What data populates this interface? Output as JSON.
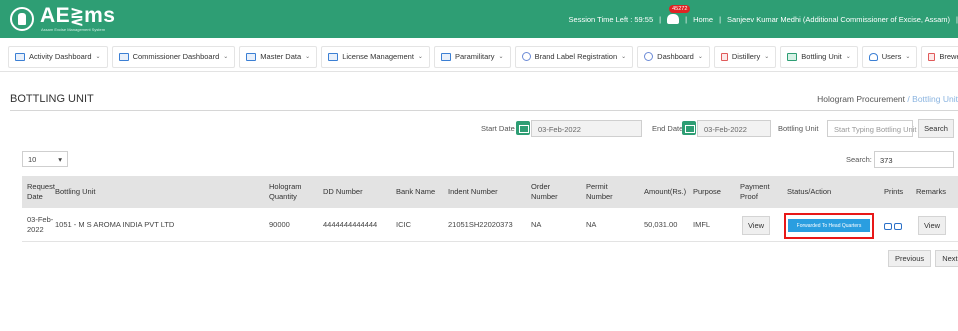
{
  "header": {
    "logo": "AE",
    "logo_tail": "ms",
    "logo_sub": "Assam Excise Management System",
    "session_label": "Session Time Left : 59:55",
    "notification_count": "45272",
    "home": "Home",
    "user": "Sanjeev Kumar Medhi (Additional Commissioner of Excise, Assam)",
    "divider": "|"
  },
  "nav": {
    "items": [
      {
        "label": "Activity Dashboard",
        "icon": "dashboard-icon"
      },
      {
        "label": "Commissioner Dashboard",
        "icon": "dashboard-icon"
      },
      {
        "label": "Master Data",
        "icon": "table-icon"
      },
      {
        "label": "License Management",
        "icon": "license-icon"
      },
      {
        "label": "Paramilitary",
        "icon": "table-icon"
      },
      {
        "label": "Brand Label Registration",
        "icon": "circle-icon"
      },
      {
        "label": "Dashboard",
        "icon": "clock-icon"
      },
      {
        "label": "Distillery",
        "icon": "flask-icon"
      },
      {
        "label": "Bottling Unit",
        "icon": "bottle-icon"
      },
      {
        "label": "Users",
        "icon": "users-icon"
      },
      {
        "label": "Brewery",
        "icon": "flask-icon"
      }
    ],
    "caret": "⌄",
    "more_arrow": "➔"
  },
  "page": {
    "title": "BOTTLING UNIT",
    "breadcrumb_parent": "Hologram Procurement",
    "breadcrumb_sep": "/",
    "breadcrumb_current": "Bottling Unit"
  },
  "filters": {
    "start_label": "Start Date",
    "start_value": "03-Feb-2022",
    "end_label": "End Date",
    "end_value": "03-Feb-2022",
    "unit_label": "Bottling Unit",
    "unit_placeholder": "Start Typing Bottling Unit",
    "search_button": "Search"
  },
  "table_controls": {
    "page_length": "10",
    "length_caret": "▾",
    "search_label": "Search:",
    "search_value": "373"
  },
  "table": {
    "headers": {
      "request_date": [
        "Request",
        "Date"
      ],
      "bottling_unit": "Bottling Unit",
      "hologram_qty": [
        "Hologram",
        "Quantity"
      ],
      "dd_number": "DD Number",
      "bank_name": "Bank Name",
      "indent_number": "Indent Number",
      "order_number": [
        "Order",
        "Number"
      ],
      "permit_number": [
        "Permit",
        "Number"
      ],
      "amount": "Amount(Rs.)",
      "purpose": "Purpose",
      "payment_proof": [
        "Payment",
        "Proof"
      ],
      "status_action": "Status/Action",
      "prints": "Prints",
      "remarks": "Remarks"
    },
    "rows": [
      {
        "request_date": [
          "03-Feb-",
          "2022"
        ],
        "bottling_unit": "1051 - M S AROMA INDIA PVT LTD",
        "hologram_qty": "90000",
        "dd_number": "4444444444444",
        "bank_name": "ICIC",
        "indent_number": "21051SH22020373",
        "order_number": "NA",
        "permit_number": "NA",
        "amount": "50,031.00",
        "purpose": "IMFL",
        "payment_proof": "View",
        "status": "Forwarded To Head Quarters",
        "remarks": "View"
      }
    ]
  },
  "pagination": {
    "previous": "Previous",
    "next": "Next"
  }
}
